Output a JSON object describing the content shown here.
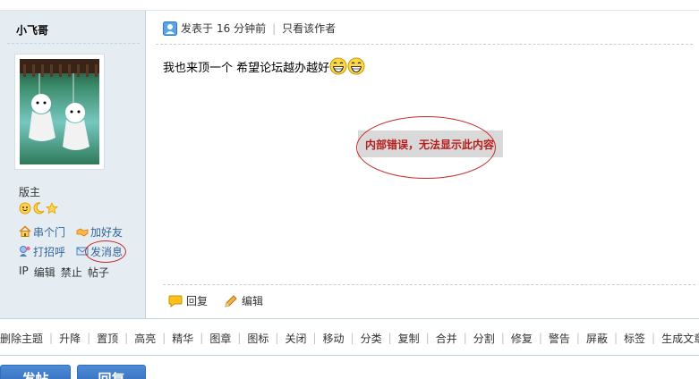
{
  "sidebar": {
    "author": "小飞哥",
    "rank": "版主",
    "links": {
      "visit": "串个门",
      "add_friend": "加好友",
      "greet": "打招呼",
      "message": "发消息"
    },
    "admin": [
      "IP",
      "编辑",
      "禁止",
      "帖子"
    ]
  },
  "post": {
    "posted_prefix": "发表于",
    "posted_time": "16 分钟前",
    "only_author": "只看该作者",
    "content": "我也来顶一个 希望论坛越办越好",
    "error": "内部错误，无法显示此内容",
    "reply": "回复",
    "edit": "编辑"
  },
  "modbar": [
    "删除主题",
    "升降",
    "置顶",
    "高亮",
    "精华",
    "图章",
    "图标",
    "关闭",
    "移动",
    "分类",
    "复制",
    "合并",
    "分割",
    "修复",
    "警告",
    "屏蔽",
    "标签",
    "生成文章"
  ],
  "buttons": {
    "post": "发帖",
    "reply": "回复"
  },
  "colors": {
    "sidebar_bg": "#e5edf2",
    "link": "#336699",
    "error": "#b71c1c",
    "annotation": "#c62828",
    "button": "#2b66b8"
  }
}
